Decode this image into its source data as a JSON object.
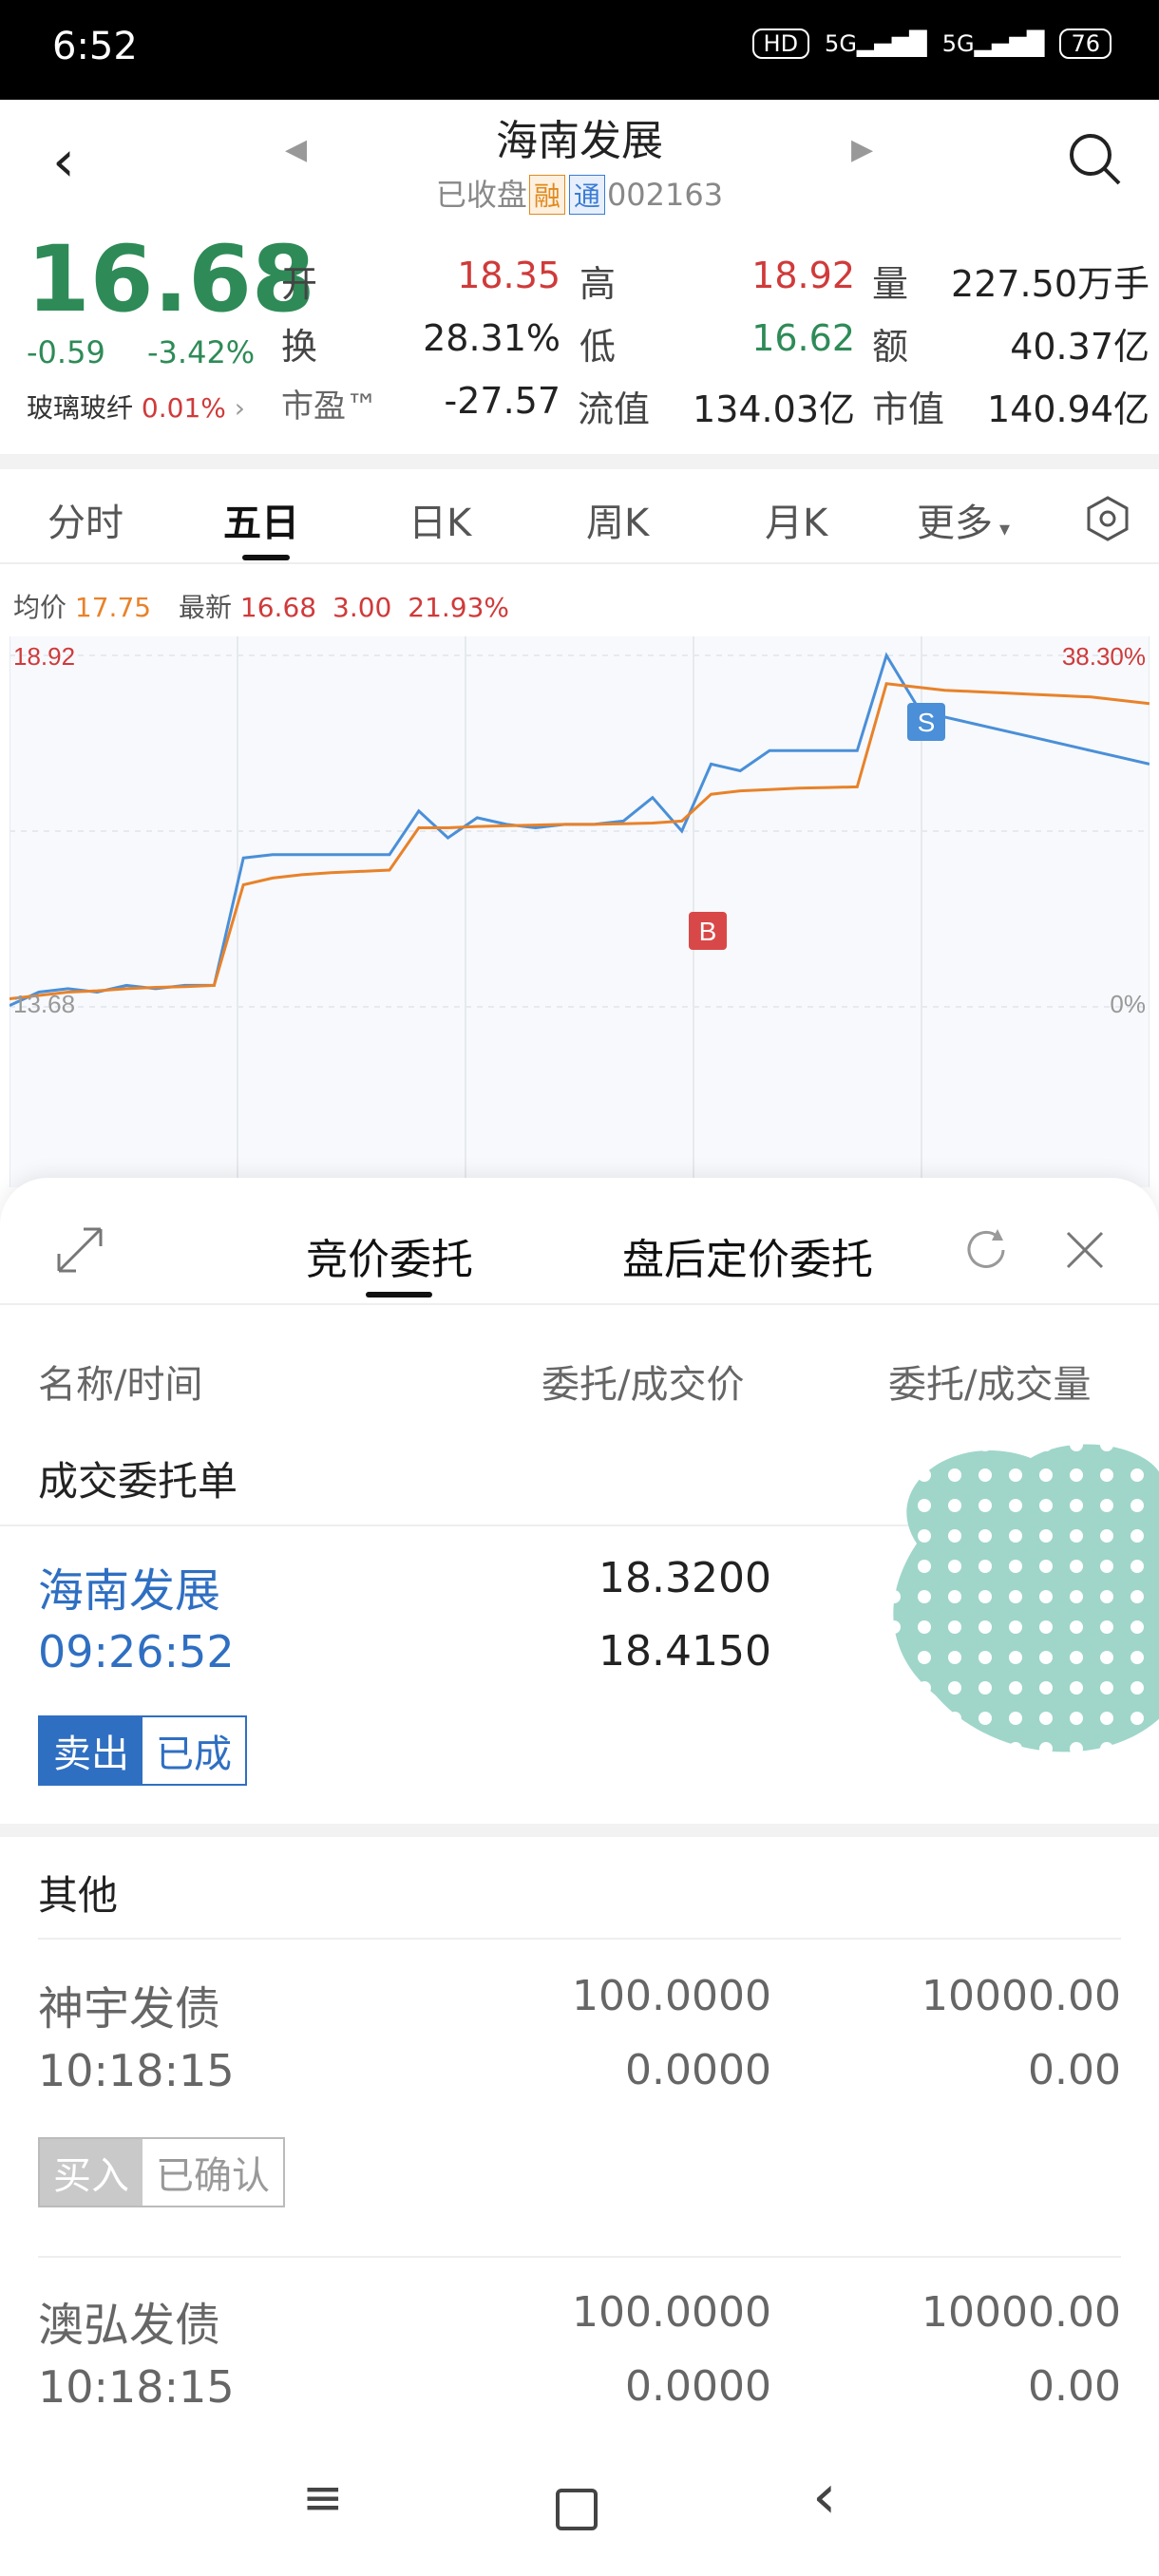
{
  "status_bar": {
    "time": "6:52",
    "hd": "HD",
    "net1": "5G",
    "net2": "5G",
    "battery": "76"
  },
  "header": {
    "title": "海南发展",
    "status": "已收盘",
    "tag_rong": "融",
    "tag_tong": "通",
    "code": "002163"
  },
  "quote": {
    "price": "16.68",
    "change": "-0.59",
    "change_pct": "-3.42%",
    "sector_name": "玻璃玻纤",
    "sector_pct": "0.01%",
    "open_label": "开",
    "open": "18.35",
    "high_label": "高",
    "high": "18.92",
    "vol_label": "量",
    "vol": "227.50万手",
    "turn_label": "换",
    "turn": "28.31%",
    "low_label": "低",
    "low": "16.62",
    "amt_label": "额",
    "amt": "40.37亿",
    "pe_label": "市盈™",
    "pe": "-27.57",
    "float_label": "流值",
    "float": "134.03亿",
    "mcap_label": "市值",
    "mcap": "140.94亿"
  },
  "tabs": [
    "分时",
    "五日",
    "日K",
    "周K",
    "月K",
    "更多"
  ],
  "legend": {
    "avg_label": "均价",
    "avg": "17.75",
    "latest_label": "最新",
    "latest": "16.68",
    "chg": "3.00",
    "chg_pct": "21.93%"
  },
  "chart_data": {
    "type": "line",
    "ylim": [
      13.68,
      18.92
    ],
    "y_top_label": "18.92",
    "y_bottom_label": "13.68",
    "right_top_label": "38.30%",
    "right_bottom_label": "0%",
    "markers": [
      {
        "label": "B"
      },
      {
        "label": "S"
      }
    ],
    "series": [
      {
        "color": "#4a8fd8",
        "values": [
          13.7,
          13.9,
          13.95,
          13.9,
          14.0,
          13.95,
          14.0,
          14.0,
          15.9,
          15.95,
          15.95,
          15.95,
          15.95,
          15.95,
          16.6,
          16.2,
          16.5,
          16.4,
          16.35,
          16.4,
          16.4,
          16.45,
          16.8,
          16.3,
          17.3,
          17.2,
          17.5,
          17.5,
          17.5,
          17.5,
          18.92,
          18.2,
          18.0,
          17.9,
          17.8,
          17.7,
          17.6,
          17.5,
          17.4,
          17.3
        ]
      },
      {
        "color": "#e8822a",
        "values": [
          13.8,
          13.85,
          13.9,
          13.92,
          13.95,
          13.97,
          13.98,
          14.0,
          15.5,
          15.6,
          15.65,
          15.68,
          15.7,
          15.72,
          16.35,
          16.35,
          16.37,
          16.38,
          16.39,
          16.4,
          16.4,
          16.41,
          16.42,
          16.45,
          16.85,
          16.9,
          16.92,
          16.94,
          16.95,
          16.96,
          18.5,
          18.45,
          18.4,
          18.38,
          18.36,
          18.34,
          18.32,
          18.3,
          18.25,
          18.2
        ]
      }
    ]
  },
  "sheet": {
    "tab1": "竞价委托",
    "tab2": "盘后定价委托",
    "col_name": "名称/时间",
    "col_price": "委托/成交价",
    "col_qty": "委托/成交量",
    "section1": "成交委托单",
    "orders": [
      {
        "name": "海南发展",
        "time": "09:26:52",
        "price1": "18.3200",
        "price2": "18.4150",
        "qty1": "",
        "qty2": "",
        "side": "卖出",
        "state": "已成"
      }
    ],
    "section2": "其他",
    "others": [
      {
        "name": "神宇发债",
        "time": "10:18:15",
        "price1": "100.0000",
        "price2": "0.0000",
        "qty1": "10000.00",
        "qty2": "0.00",
        "side": "买入",
        "state": "已确认"
      },
      {
        "name": "澳弘发债",
        "time": "10:18:15",
        "price1": "100.0000",
        "price2": "0.0000",
        "qty1": "10000.00",
        "qty2": "0.00"
      }
    ]
  }
}
